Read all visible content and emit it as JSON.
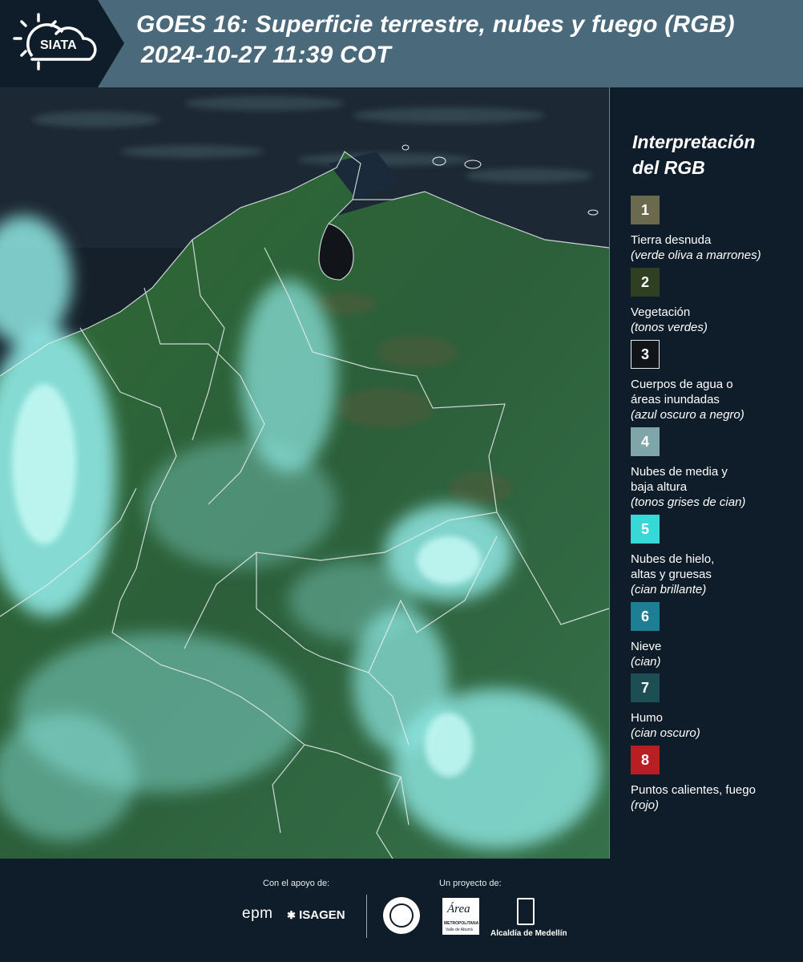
{
  "header": {
    "logo_text": "SIATA",
    "title_line1": "GOES 16: Superficie terrestre, nubes y fuego (RGB)",
    "title_line2": "2024-10-27 11:39 COT"
  },
  "legend": {
    "heading_line1": "Interpretación",
    "heading_line2": "del RGB",
    "items": [
      {
        "num": "1",
        "label": "Tierra desnuda",
        "desc": "(verde oliva a marrones)",
        "color": "#6b6a4e"
      },
      {
        "num": "2",
        "label": "Vegetación",
        "desc": "(tonos verdes)",
        "color": "#2e3f22"
      },
      {
        "num": "3",
        "label_line1": "Cuerpos de agua o",
        "label_line2": "áreas inundadas",
        "desc": "(azul oscuro a negro)",
        "color": "#111418"
      },
      {
        "num": "4",
        "label_line1": "Nubes de media y",
        "label_line2": "baja altura",
        "desc": "(tonos grises de cian)",
        "color": "#7fa5a8"
      },
      {
        "num": "5",
        "label_line1": "Nubes de hielo,",
        "label_line2": "altas y gruesas",
        "desc": "(cian brillante)",
        "color": "#38d8d6"
      },
      {
        "num": "6",
        "label": "Nieve",
        "desc": "(cian)",
        "color": "#1f7d94"
      },
      {
        "num": "7",
        "label": "Humo",
        "desc": "(cian oscuro)",
        "color": "#1d4e54"
      },
      {
        "num": "8",
        "label": "Puntos calientes, fuego",
        "desc": "(rojo)",
        "color": "#b81e23"
      }
    ]
  },
  "footer": {
    "support_caption": "Con el apoyo de:",
    "project_caption": "Un proyecto de:",
    "epm": "epm",
    "isagen": "ISAGEN",
    "area_logo": "Área",
    "area_sub": "METROPOLITANA",
    "area_sub2": "Valle de Aburrá",
    "medellin": "Alcaldía de Medellín"
  }
}
